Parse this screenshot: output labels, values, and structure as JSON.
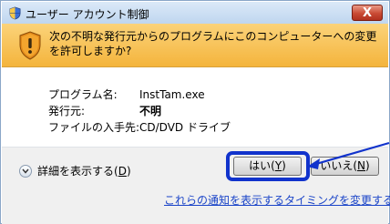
{
  "window": {
    "title": "ユーザー アカウント制御",
    "close_label": "X"
  },
  "banner": {
    "message": "次の不明な発行元からのプログラムにこのコンピューターへの変更を許可しますか?"
  },
  "info": {
    "program_label": "プログラム名:",
    "program_value": "InstTam.exe",
    "publisher_label": "発行元:",
    "publisher_value": "不明",
    "source_label": "ファイルの入手先:",
    "source_value": "CD/DVD ドライブ"
  },
  "footer": {
    "details_label": "詳細を表示する",
    "details_key": "D",
    "yes_label": "はい",
    "yes_key": "Y",
    "no_label": "いいえ",
    "no_key": "N",
    "link_text": "これらの通知を表示するタイミングを変更する"
  },
  "colors": {
    "highlight": "#1133cc",
    "banner": "#f4b43c",
    "link": "#1a44c8"
  }
}
